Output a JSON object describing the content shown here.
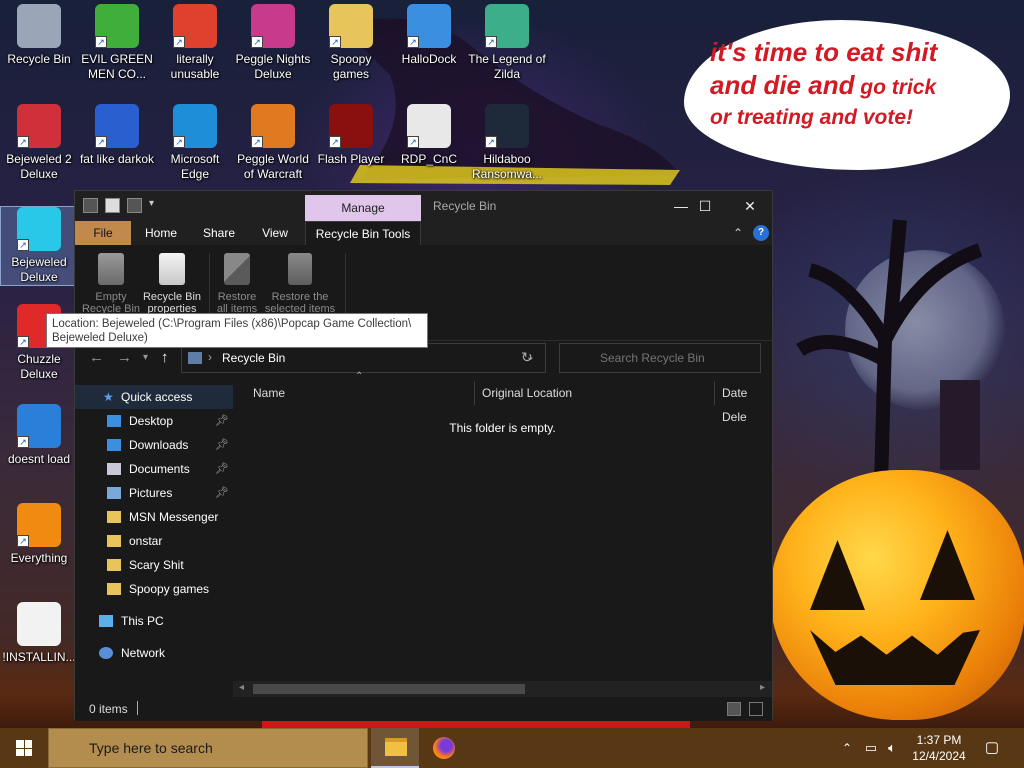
{
  "wallpaper": {
    "speech_line1": "it's time to eat shit",
    "speech_line2a": "and die and",
    "speech_line2b": " go trick",
    "speech_line3": "or treating and vote!"
  },
  "desktop_icons": [
    {
      "label": "Recycle Bin",
      "icon": "recycle-bin-icon",
      "color": "#9aa5b8"
    },
    {
      "label": "EVIL GREEN MEN CO...",
      "icon": "msn-buddies-icon",
      "color": "#3fae3a"
    },
    {
      "label": "literally unusable",
      "icon": "chrome-icon",
      "color": "#e0412f"
    },
    {
      "label": "Peggle Nights Deluxe",
      "icon": "peggle-nights-icon",
      "color": "#c83a8c"
    },
    {
      "label": "Spoopy games",
      "icon": "folder-icon",
      "color": "#e8c55a"
    },
    {
      "label": "HalloDock",
      "icon": "windows-logo-icon",
      "color": "#3a8fe0"
    },
    {
      "label": "The Legend of Zilda",
      "icon": "zilda-icon",
      "color": "#3cae8a"
    },
    {
      "label": "Bejeweled 2 Deluxe",
      "icon": "bejeweled-2-icon",
      "color": "#d0303a"
    },
    {
      "label": "fat like darkok",
      "icon": "mpl-icon",
      "color": "#2a5fd0"
    },
    {
      "label": "Microsoft Edge",
      "icon": "edge-icon",
      "color": "#1f8ed8"
    },
    {
      "label": "Peggle World of Warcraft",
      "icon": "peggle-wow-icon",
      "color": "#e07a20"
    },
    {
      "label": "Flash Player",
      "icon": "flash-player-icon",
      "color": "#8a1010"
    },
    {
      "label": "RDP_CnC",
      "icon": "rdp-icon",
      "color": "#e8e8e8"
    },
    {
      "label": "Hildaboo Ransomwa...",
      "icon": "yashma-shield-icon",
      "color": "#1e2a3a"
    },
    {
      "label": "Bejeweled Deluxe",
      "icon": "diamond-icon",
      "color": "#2ac8e8"
    },
    {
      "label": "Chuzzle Deluxe",
      "icon": "chuzzle-icon",
      "color": "#e02a2a"
    },
    {
      "label": "doesnt load",
      "icon": "thunderbird-icon",
      "color": "#2a7fd8"
    },
    {
      "label": "Everything",
      "icon": "everything-search-icon",
      "color": "#f08a10"
    },
    {
      "label": "!INSTALLIN...",
      "icon": "text-file-icon",
      "color": "#f2f2f2"
    }
  ],
  "tooltip": {
    "line1": "Location: Bejeweled (C:\\Program Files (x86)\\Popcap Game Collection\\",
    "line2": "Bejeweled Deluxe)"
  },
  "explorer": {
    "context_tab": "Manage",
    "title": "Recycle Bin",
    "controls": {
      "minimize": "—",
      "maximize": "☐",
      "close": "✕"
    },
    "tabs": [
      "File",
      "Home",
      "Share",
      "View",
      "Recycle Bin Tools"
    ],
    "ribbon": {
      "empty_line1": "Empty",
      "empty_line2": "Recycle Bin",
      "props_line1": "Recycle Bin",
      "props_line2": "properties",
      "restore_all_line1": "Restore",
      "restore_all_line2": "all items",
      "restore_sel_line1": "Restore the",
      "restore_sel_line2": "selected items"
    },
    "address": {
      "path": "Recycle Bin"
    },
    "search_placeholder": "Search Recycle Bin",
    "nav": {
      "quick_access": "Quick access",
      "items": [
        "Desktop",
        "Downloads",
        "Documents",
        "Pictures",
        "MSN Messenger",
        "onstar",
        "Scary Shit",
        "Spoopy games"
      ],
      "this_pc": "This PC",
      "network": "Network"
    },
    "columns": [
      "Name",
      "Original Location",
      "Date Dele"
    ],
    "empty_message": "This folder is empty.",
    "status": "0 items"
  },
  "taskbar": {
    "search_placeholder": "Type here to search",
    "time": "1:37 PM",
    "date": "12/4/2024"
  },
  "colors": {
    "file_tab": "#c2894c",
    "manage_tab": "#e0c6ea",
    "taskbar": "#5a3a14",
    "speech_text": "#d11a23"
  }
}
